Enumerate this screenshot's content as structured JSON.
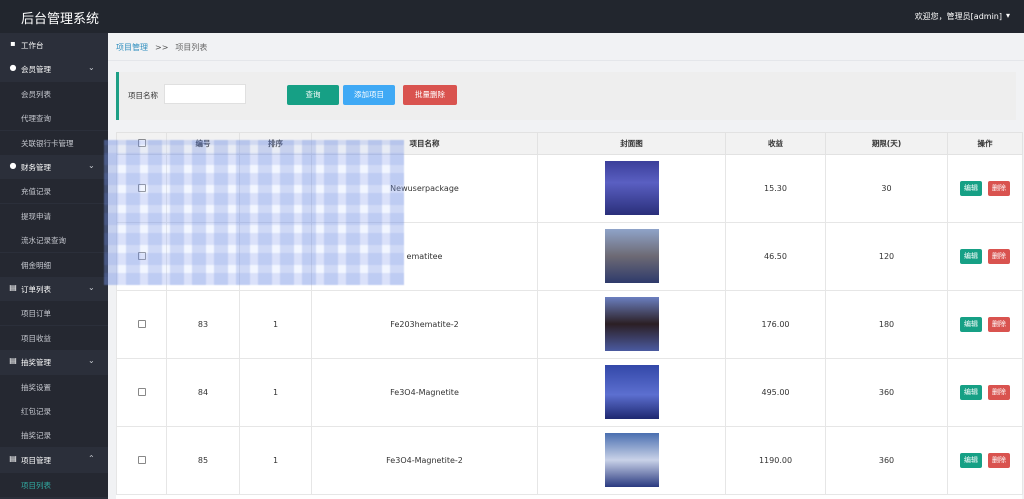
{
  "app": {
    "title": "后台管理系统",
    "welcome": "欢迎您，管理员[admin]",
    "caret": "▾"
  },
  "sidebar": {
    "items": [
      {
        "type": "group",
        "label": "工作台",
        "icon": "dashboard-icon",
        "chev": ""
      },
      {
        "type": "group",
        "label": "会员管理",
        "icon": "user-icon",
        "chev": "⌄"
      },
      {
        "type": "sub",
        "label": "会员列表"
      },
      {
        "type": "sub",
        "label": "代理查询"
      },
      {
        "type": "sub",
        "label": "关联银行卡管理"
      },
      {
        "type": "group",
        "label": "财务管理",
        "icon": "finance-icon",
        "chev": "⌄"
      },
      {
        "type": "sub",
        "label": "充值记录"
      },
      {
        "type": "sub",
        "label": "提现申请"
      },
      {
        "type": "sub",
        "label": "流水记录查询"
      },
      {
        "type": "sub",
        "label": "佣金明细"
      },
      {
        "type": "group",
        "label": "订单列表",
        "icon": "order-icon",
        "chev": "⌄"
      },
      {
        "type": "sub",
        "label": "项目订单"
      },
      {
        "type": "sub",
        "label": "项目收益"
      },
      {
        "type": "group",
        "label": "抽奖管理",
        "icon": "lottery-icon",
        "chev": "⌄"
      },
      {
        "type": "sub",
        "label": "抽奖设置"
      },
      {
        "type": "sub",
        "label": "红包记录"
      },
      {
        "type": "sub",
        "label": "抽奖记录"
      },
      {
        "type": "group",
        "label": "项目管理",
        "icon": "project-icon",
        "chev": "⌃"
      },
      {
        "type": "sub",
        "label": "项目列表",
        "active": true
      }
    ]
  },
  "breadcrumb": {
    "first": "项目管理",
    "sep": ">>",
    "second": "项目列表"
  },
  "search": {
    "label": "项目名称",
    "value": "",
    "placeholder": "",
    "query_btn": "查询",
    "add_btn": "添加项目",
    "batch_del_btn": "批量删除"
  },
  "table": {
    "headers": [
      "",
      "编号",
      "排序",
      "项目名称",
      "封面图",
      "收益",
      "期限(天)",
      "操作"
    ],
    "rows": [
      {
        "id": "",
        "sort": "",
        "name": "Newuserpackage",
        "income": "15.30",
        "days": "30"
      },
      {
        "id": "",
        "sort": "",
        "name": "ematitee",
        "income": "46.50",
        "days": "120"
      },
      {
        "id": "83",
        "sort": "1",
        "name": "Fe203hematite-2",
        "income": "176.00",
        "days": "180"
      },
      {
        "id": "84",
        "sort": "1",
        "name": "Fe3O4-Magnetite",
        "income": "495.00",
        "days": "360"
      },
      {
        "id": "85",
        "sort": "1",
        "name": "Fe3O4-Magnetite-2",
        "income": "1190.00",
        "days": "360"
      }
    ],
    "edit_label": "编辑",
    "delete_label": "删除"
  },
  "colors": {
    "sidebar": "#2b2f3a",
    "topbar": "#22262e",
    "accent": "#16a085",
    "add": "#3fa9f5",
    "danger": "#d9534f"
  }
}
